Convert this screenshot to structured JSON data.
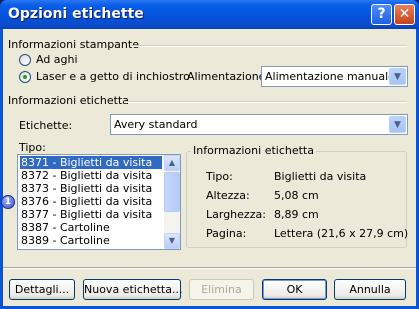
{
  "window": {
    "title": "Opzioni etichette",
    "help_glyph": "?",
    "close_glyph": "✕",
    "colors": {
      "titlebar": "#0454de",
      "client": "#ece9d8",
      "selection": "#316ac5"
    }
  },
  "printer_info": {
    "label": "Informazioni stampante",
    "radio_dot_matrix": "Ad aghi",
    "radio_laser": "Laser e a getto di inchiostro",
    "selected": "Laser e a getto di inchiostro",
    "feed_label": "Alimentazione:",
    "feed_value": "Alimentazione manuale"
  },
  "label_info": {
    "label": "Informazioni etichetta",
    "labels_label": "Etichette:",
    "labels_value": "Avery standard",
    "type_label": "Tipo:",
    "type_items": [
      "8371 - Biglietti da visita",
      "8372 - Biglietti da visita",
      "8373 - Biglietti da visita",
      "8376 - Biglietti da visita",
      "8377 - Biglietti da visita",
      "8387 - Cartoline",
      "8389 - Cartoline"
    ],
    "selected_type": "8371 - Biglietti da visita"
  },
  "details_box": {
    "title": "Informazioni etichetta",
    "rows": [
      {
        "key": "Tipo:",
        "value": "Biglietti da visita"
      },
      {
        "key": "Altezza:",
        "value": "5,08 cm"
      },
      {
        "key": "Larghezza:",
        "value": "8,89 cm"
      },
      {
        "key": "Pagina:",
        "value": "Lettera (21,6 x 27,9 cm)"
      }
    ]
  },
  "buttons": {
    "details": "Dettagli...",
    "new_label": "Nuova etichetta...",
    "delete": "Elimina",
    "ok": "OK",
    "cancel": "Annulla"
  },
  "badge": "1",
  "icons": {
    "help": "help-icon",
    "close": "close-icon",
    "dropdown": "chevron-down-icon",
    "scroll_up": "scroll-up-icon",
    "scroll_down": "scroll-down-icon"
  }
}
